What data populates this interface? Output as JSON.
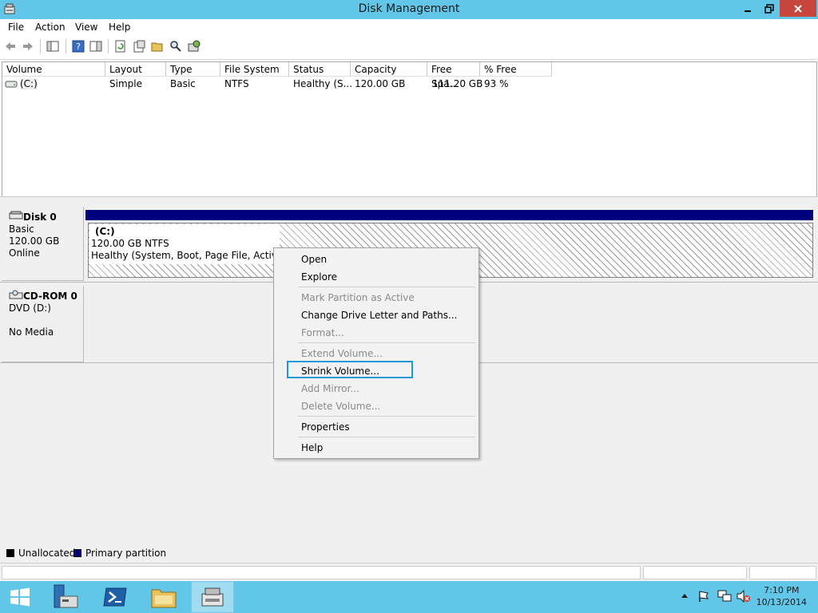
{
  "window": {
    "title": "Disk Management"
  },
  "menubar": [
    "File",
    "Action",
    "View",
    "Help"
  ],
  "volume_list": {
    "columns": [
      "Volume",
      "Layout",
      "Type",
      "File System",
      "Status",
      "Capacity",
      "Free Spa...",
      "% Free"
    ],
    "rows": [
      [
        "(C:)",
        "Simple",
        "Basic",
        "NTFS",
        "Healthy (S...",
        "120.00 GB",
        "111.20 GB",
        "93 %"
      ]
    ]
  },
  "disks": [
    {
      "name": "Disk 0",
      "line1": "Basic",
      "line2": "120.00 GB",
      "line3": "Online"
    },
    {
      "name": "CD-ROM 0",
      "line1": "DVD (D:)",
      "line2": "",
      "line3": "No Media"
    }
  ],
  "partition": {
    "label": "(C:)",
    "size": "120.00 GB NTFS",
    "status": "Healthy (System, Boot, Page File, Active, Cr"
  },
  "context_menu": {
    "items": [
      {
        "label": "Open",
        "enabled": true
      },
      {
        "label": "Explore",
        "enabled": true
      },
      {
        "label": "Mark Partition as Active",
        "enabled": false
      },
      {
        "label": "Change Drive Letter and Paths...",
        "enabled": true
      },
      {
        "label": "Format...",
        "enabled": false
      },
      {
        "label": "Extend Volume...",
        "enabled": false
      },
      {
        "label": "Shrink Volume...",
        "enabled": true,
        "highlighted": true
      },
      {
        "label": "Add Mirror...",
        "enabled": false
      },
      {
        "label": "Delete Volume...",
        "enabled": false
      },
      {
        "label": "Properties",
        "enabled": true
      },
      {
        "label": "Help",
        "enabled": true
      }
    ]
  },
  "legend": [
    {
      "label": "Unallocated",
      "color": "#000000"
    },
    {
      "label": "Primary partition",
      "color": "#00007f"
    }
  ],
  "taskbar": {
    "time": "7:10 PM",
    "date": "10/13/2014",
    "pinned_icons": [
      "start-icon",
      "server-manager-icon",
      "powershell-icon",
      "file-explorer-icon",
      "disk-management-icon"
    ]
  },
  "colors": {
    "titlebar": "#61c6e8",
    "highlight_border": "#1e9bd7",
    "partition_bar": "#00007f"
  }
}
